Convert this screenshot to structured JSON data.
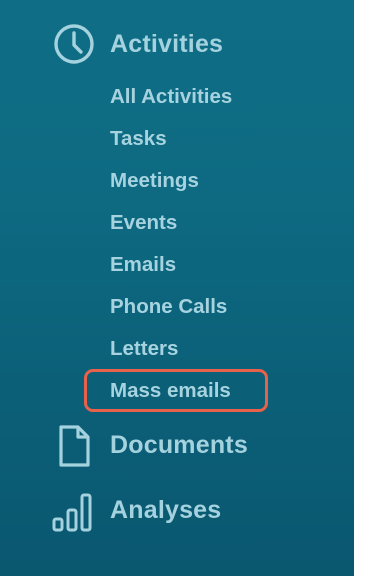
{
  "sidebar": {
    "sections": {
      "activities": {
        "label": "Activities",
        "icon": "clock-icon"
      },
      "documents": {
        "label": "Documents",
        "icon": "document-icon"
      },
      "analyses": {
        "label": "Analyses",
        "icon": "bar-chart-icon"
      }
    },
    "activity_items": [
      {
        "label": "All Activities"
      },
      {
        "label": "Tasks"
      },
      {
        "label": "Meetings"
      },
      {
        "label": "Events"
      },
      {
        "label": "Emails"
      },
      {
        "label": "Phone Calls"
      },
      {
        "label": "Letters"
      },
      {
        "label": "Mass emails",
        "highlighted": true
      }
    ]
  },
  "colors": {
    "sidebar_background": "#0d6a81",
    "text": "#a6d3df",
    "highlight_border": "#e8614a"
  }
}
